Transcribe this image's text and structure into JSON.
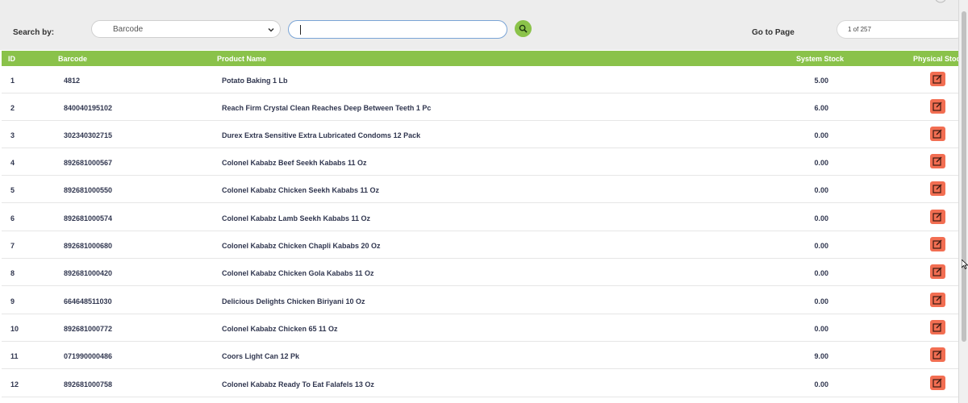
{
  "toolbar": {
    "search_label": "Search by:",
    "search_by_selected": "Barcode",
    "search_value": "",
    "goto_label": "Go to Page",
    "goto_value": "1 of 257"
  },
  "colors": {
    "header_green": "#8ac24a",
    "search_button_green": "#8bc34a",
    "edit_button_orange": "#f26e52",
    "text_dark": "#30364f"
  },
  "icons": {
    "select": "chevron-down-icon",
    "search": "search-icon",
    "edit": "edit-icon",
    "cursor": "mouse-pointer-icon"
  },
  "table": {
    "columns": [
      "ID",
      "Barcode",
      "Product Name",
      "System Stock",
      "Physical Stock"
    ],
    "rows": [
      {
        "id": "1",
        "barcode": "4812",
        "name": "Potato Baking 1 Lb",
        "stock": "5.00"
      },
      {
        "id": "2",
        "barcode": "840040195102",
        "name": "Reach Firm Crystal Clean Reaches Deep Between Teeth 1 Pc",
        "stock": "6.00"
      },
      {
        "id": "3",
        "barcode": "302340302715",
        "name": "Durex Extra Sensitive Extra Lubricated Condoms 12 Pack",
        "stock": "0.00"
      },
      {
        "id": "4",
        "barcode": "892681000567",
        "name": "Colonel Kababz Beef Seekh Kababs  11 Oz",
        "stock": "0.00"
      },
      {
        "id": "5",
        "barcode": "892681000550",
        "name": "Colonel Kababz Chicken Seekh Kababs 11 Oz",
        "stock": "0.00"
      },
      {
        "id": "6",
        "barcode": "892681000574",
        "name": "Colonel Kababz Lamb Seekh Kababs 11 Oz",
        "stock": "0.00"
      },
      {
        "id": "7",
        "barcode": "892681000680",
        "name": "Colonel Kababz Chicken Chapli Kababs 20 Oz",
        "stock": "0.00"
      },
      {
        "id": "8",
        "barcode": "892681000420",
        "name": "Colonel Kababz Chicken Gola Kababs 11 Oz",
        "stock": "0.00"
      },
      {
        "id": "9",
        "barcode": "664648511030",
        "name": "Delicious Delights Chicken Biriyani 10 Oz",
        "stock": "0.00"
      },
      {
        "id": "10",
        "barcode": "892681000772",
        "name": "Colonel Kababz Chicken 65 11 Oz",
        "stock": "0.00"
      },
      {
        "id": "11",
        "barcode": "071990000486",
        "name": "Coors Light Can 12 Pk",
        "stock": "9.00"
      },
      {
        "id": "12",
        "barcode": "892681000758",
        "name": "Colonel Kababz Ready To Eat Falafels 13 Oz",
        "stock": "0.00"
      }
    ]
  }
}
